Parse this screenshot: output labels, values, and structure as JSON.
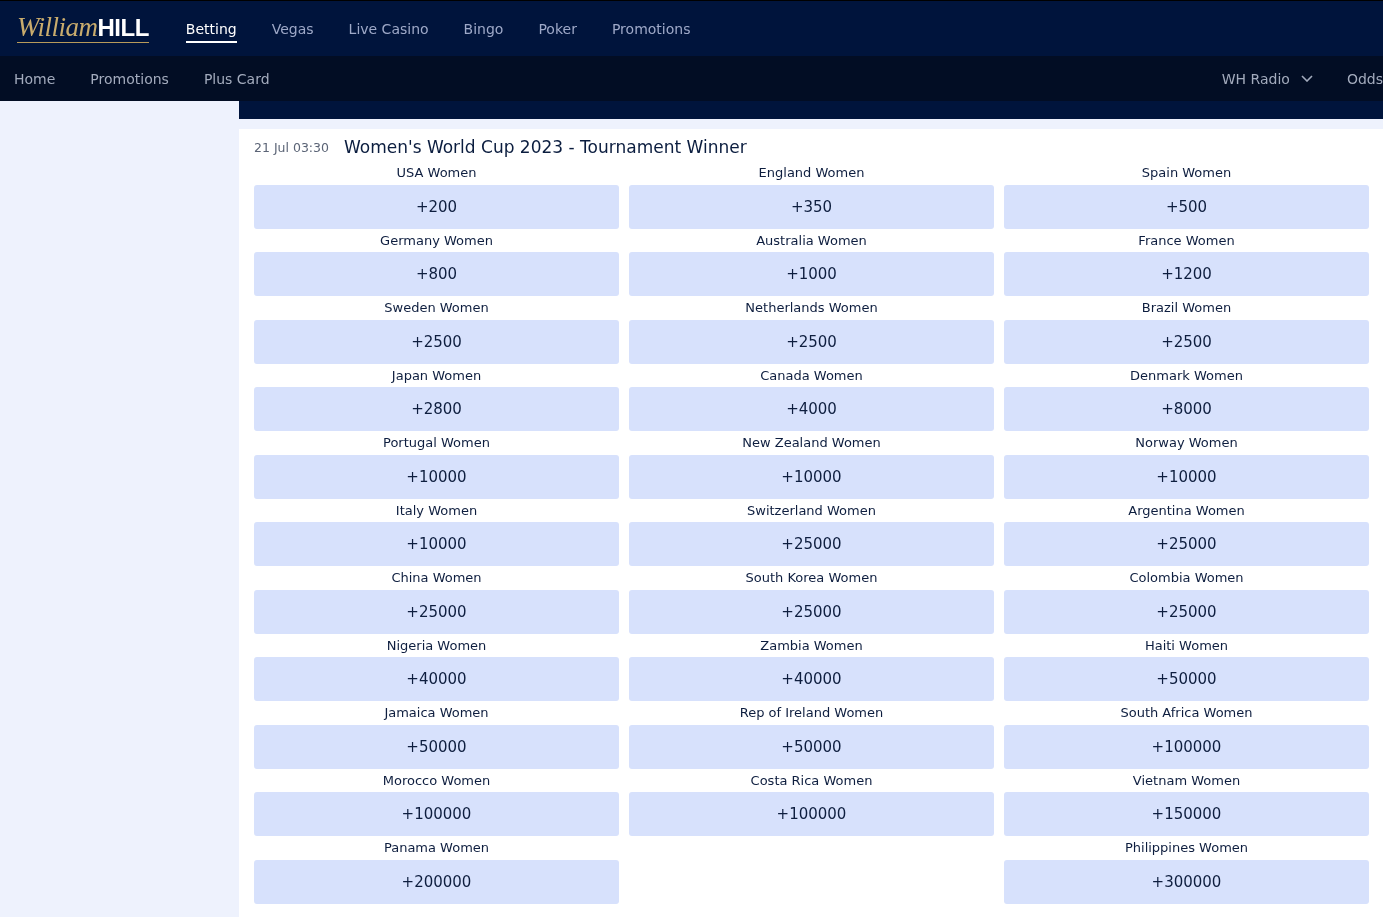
{
  "logo": {
    "script": "William",
    "wordmark": "HILL"
  },
  "top_nav": [
    {
      "label": "Betting",
      "selected": true
    },
    {
      "label": "Vegas",
      "selected": false
    },
    {
      "label": "Live Casino",
      "selected": false
    },
    {
      "label": "Bingo",
      "selected": false
    },
    {
      "label": "Poker",
      "selected": false
    },
    {
      "label": "Promotions",
      "selected": false
    }
  ],
  "sub_nav": {
    "left": [
      "Home",
      "Promotions",
      "Plus Card"
    ],
    "right": [
      {
        "kind": "dropdown",
        "label": "WH Radio"
      },
      {
        "kind": "link",
        "label": "Odds"
      }
    ]
  },
  "market": {
    "date": "21 Jul 03:30",
    "title": "Women's World Cup 2023 - Tournament Winner",
    "selections": [
      {
        "kind": "selection",
        "name": "USA Women",
        "odds": "+200"
      },
      {
        "kind": "selection",
        "name": "England Women",
        "odds": "+350"
      },
      {
        "kind": "selection",
        "name": "Spain Women",
        "odds": "+500"
      },
      {
        "kind": "selection",
        "name": "Germany Women",
        "odds": "+800"
      },
      {
        "kind": "selection",
        "name": "Australia Women",
        "odds": "+1000"
      },
      {
        "kind": "selection",
        "name": "France Women",
        "odds": "+1200"
      },
      {
        "kind": "selection",
        "name": "Sweden Women",
        "odds": "+2500"
      },
      {
        "kind": "selection",
        "name": "Netherlands Women",
        "odds": "+2500"
      },
      {
        "kind": "selection",
        "name": "Brazil Women",
        "odds": "+2500"
      },
      {
        "kind": "selection",
        "name": "Japan Women",
        "odds": "+2800"
      },
      {
        "kind": "selection",
        "name": "Canada Women",
        "odds": "+4000"
      },
      {
        "kind": "selection",
        "name": "Denmark Women",
        "odds": "+8000"
      },
      {
        "kind": "selection",
        "name": "Portugal Women",
        "odds": "+10000"
      },
      {
        "kind": "selection",
        "name": "New Zealand Women",
        "odds": "+10000"
      },
      {
        "kind": "selection",
        "name": "Norway Women",
        "odds": "+10000"
      },
      {
        "kind": "selection",
        "name": "Italy Women",
        "odds": "+10000"
      },
      {
        "kind": "selection",
        "name": "Switzerland Women",
        "odds": "+25000"
      },
      {
        "kind": "selection",
        "name": "Argentina Women",
        "odds": "+25000"
      },
      {
        "kind": "selection",
        "name": "China Women",
        "odds": "+25000"
      },
      {
        "kind": "selection",
        "name": "South Korea Women",
        "odds": "+25000"
      },
      {
        "kind": "selection",
        "name": "Colombia Women",
        "odds": "+25000"
      },
      {
        "kind": "selection",
        "name": "Nigeria Women",
        "odds": "+40000"
      },
      {
        "kind": "selection",
        "name": "Zambia Women",
        "odds": "+40000"
      },
      {
        "kind": "selection",
        "name": "Haiti Women",
        "odds": "+50000"
      },
      {
        "kind": "selection",
        "name": "Jamaica Women",
        "odds": "+50000"
      },
      {
        "kind": "selection",
        "name": "Rep of Ireland Women",
        "odds": "+50000"
      },
      {
        "kind": "selection",
        "name": "South Africa Women",
        "odds": "+100000"
      },
      {
        "kind": "selection",
        "name": "Morocco Women",
        "odds": "+100000"
      },
      {
        "kind": "selection",
        "name": "Costa Rica Women",
        "odds": "+100000"
      },
      {
        "kind": "selection",
        "name": "Vietnam Women",
        "odds": "+150000"
      },
      {
        "kind": "selection",
        "name": "Panama Women",
        "odds": "+200000"
      },
      {
        "kind": "blank"
      },
      {
        "kind": "selection",
        "name": "Philippines Women",
        "odds": "+300000"
      }
    ]
  }
}
